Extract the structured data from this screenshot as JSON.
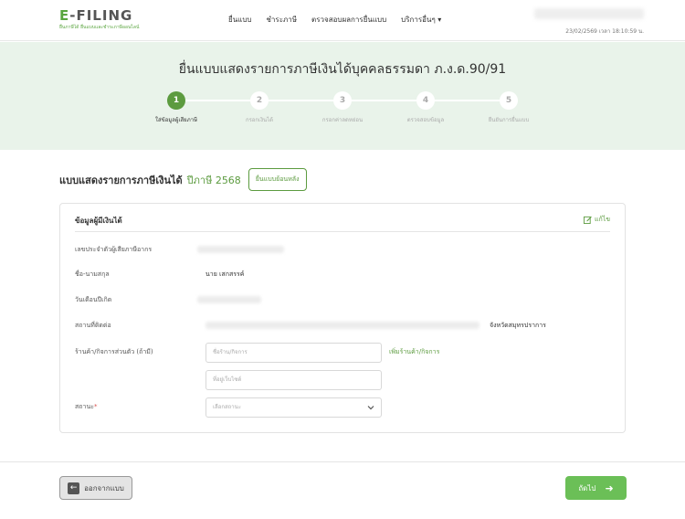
{
  "header": {
    "logo_main": "-FILING",
    "logo_e": "E",
    "logo_sub": "ยื่นภาษีได้ ยื่นแบบและชำระภาษีออนไลน์",
    "nav": [
      "ยื่นแบบ",
      "ชำระภาษี",
      "ตรวจสอบผลการยื่นแบบ",
      "บริการอื่นๆ ▾"
    ],
    "datetime": "23/02/2569 เวลา 18:10:59 น."
  },
  "hero": {
    "title": "ยื่นแบบแสดงรายการภาษีเงินได้บุคคลธรรมดา ภ.ง.ด.90/91",
    "steps": [
      {
        "num": "1",
        "label": "ใส่ข้อมูลผู้เสียภาษี"
      },
      {
        "num": "2",
        "label": "กรอกเงินได้"
      },
      {
        "num": "3",
        "label": "กรอกค่าลดหย่อน"
      },
      {
        "num": "4",
        "label": "ตรวจสอบข้อมูล"
      },
      {
        "num": "5",
        "label": "ยืนยันการยื่นแบบ"
      }
    ]
  },
  "section": {
    "title": "แบบแสดงรายการภาษีเงินได้",
    "year": "ปีภาษี 2568",
    "retro_button": "ยื่นแบบย้อนหลัง"
  },
  "card": {
    "title": "ข้อมูลผู้มีเงินได้",
    "edit": "แก้ไข",
    "rows": {
      "taxid_label": "เลขประจำตัวผู้เสียภาษีอากร",
      "name_label": "ชื่อ-นามสกุล",
      "name_value": "นาย เสกสรรค์",
      "dob_label": "วันเดือนปีเกิด",
      "address_label": "สถานที่ติดต่อ",
      "address_value": "จังหวัดสมุทรปราการ",
      "shop_label": "ร้านค้า/กิจการส่วนตัว (ถ้ามี)",
      "shop_placeholder": "ชื่อร้าน/กิจการ",
      "website_placeholder": "ที่อยู่เว็บไซต์",
      "add_shop": "เพิ่มร้านค้า/กิจการ",
      "status_label": "สถานะ",
      "status_required": "*",
      "status_placeholder": "เลือกสถานะ"
    }
  },
  "footer": {
    "back": "ออกจากแบบ",
    "next": "ถัดไป"
  },
  "colors": {
    "accent": "#5c9b3f",
    "hero_bg": "#e9f3ea",
    "next_btn": "#6bbf57"
  }
}
